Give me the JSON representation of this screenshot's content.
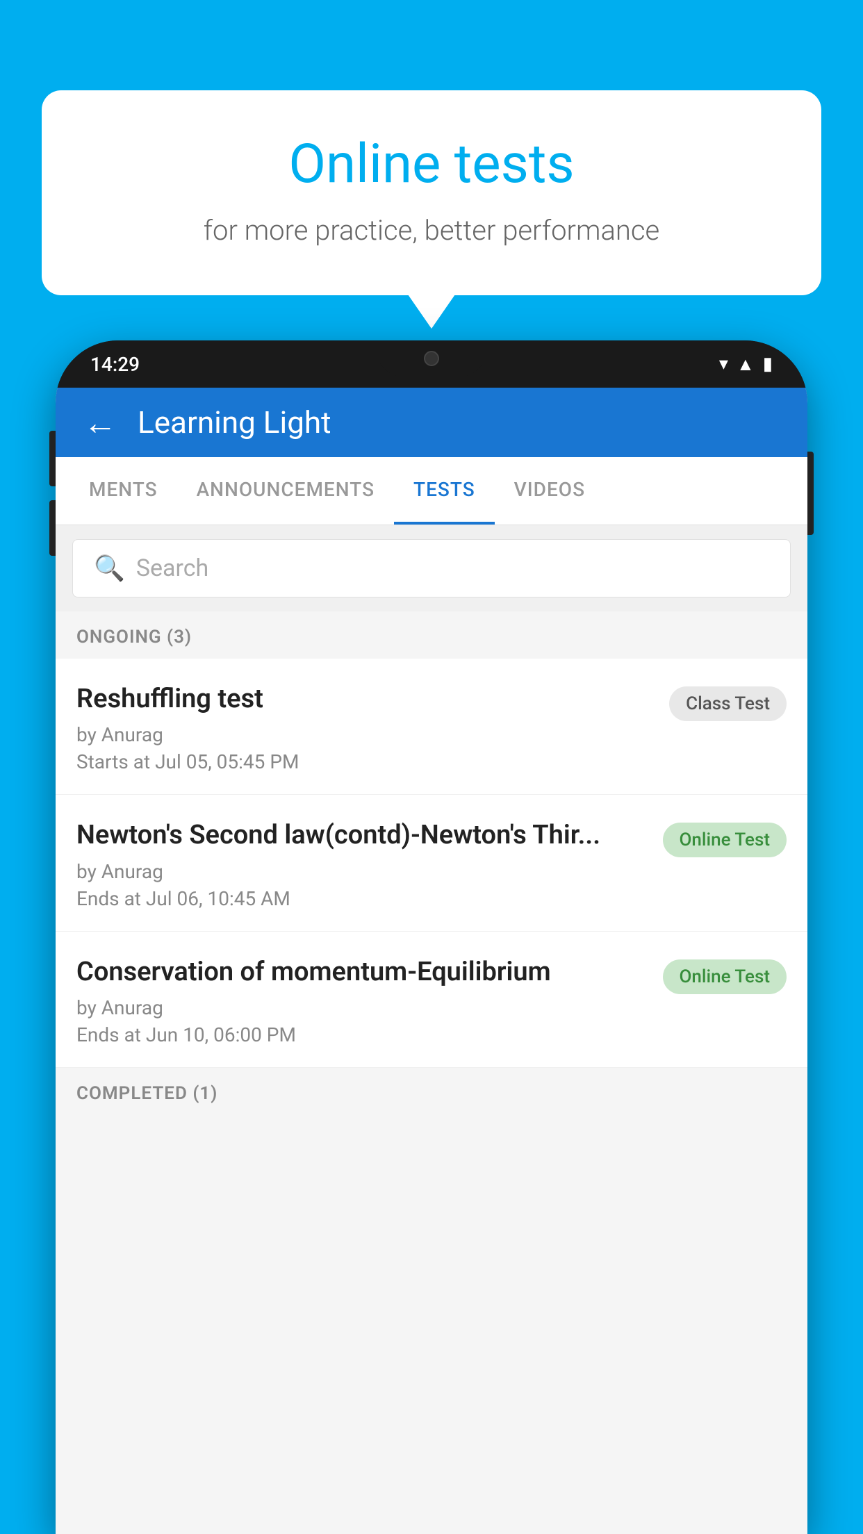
{
  "background_color": "#00AEEF",
  "speech_bubble": {
    "title": "Online tests",
    "subtitle": "for more practice, better performance"
  },
  "status_bar": {
    "time": "14:29",
    "icons": [
      "wifi",
      "signal",
      "battery"
    ]
  },
  "app_header": {
    "title": "Learning Light",
    "back_label": "←"
  },
  "tabs": [
    {
      "label": "MENTS",
      "active": false
    },
    {
      "label": "ANNOUNCEMENTS",
      "active": false
    },
    {
      "label": "TESTS",
      "active": true
    },
    {
      "label": "VIDEOS",
      "active": false
    }
  ],
  "search": {
    "placeholder": "Search"
  },
  "ongoing_section": {
    "label": "ONGOING (3)"
  },
  "tests": [
    {
      "name": "Reshuffling test",
      "author": "by Anurag",
      "date": "Starts at  Jul 05, 05:45 PM",
      "badge": "Class Test",
      "badge_type": "class"
    },
    {
      "name": "Newton's Second law(contd)-Newton's Thir...",
      "author": "by Anurag",
      "date": "Ends at  Jul 06, 10:45 AM",
      "badge": "Online Test",
      "badge_type": "online"
    },
    {
      "name": "Conservation of momentum-Equilibrium",
      "author": "by Anurag",
      "date": "Ends at  Jun 10, 06:00 PM",
      "badge": "Online Test",
      "badge_type": "online"
    }
  ],
  "completed_section": {
    "label": "COMPLETED (1)"
  }
}
